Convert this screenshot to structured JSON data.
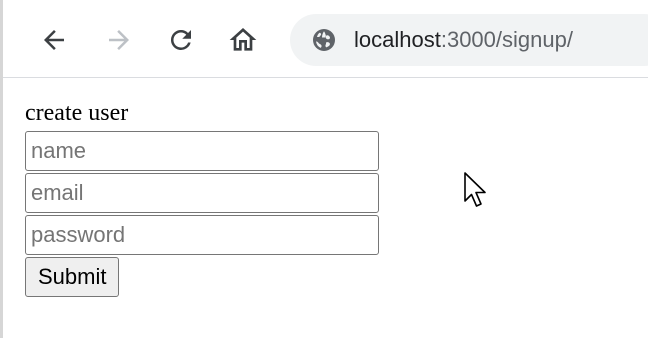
{
  "browser": {
    "back_icon": "arrow-left-icon",
    "forward_icon": "arrow-right-icon",
    "reload_icon": "reload-icon",
    "home_icon": "home-icon",
    "site_icon": "globe-icon",
    "url": {
      "host": "localhost",
      "rest": ":3000/signup/"
    }
  },
  "form": {
    "heading": "create user",
    "name_placeholder": "name",
    "email_placeholder": "email",
    "password_placeholder": "password",
    "name_value": "",
    "email_value": "",
    "password_value": "",
    "submit_label": "Submit"
  },
  "colors": {
    "icon_active": "#3c4043",
    "icon_disabled": "#bdc1c6",
    "omnibox_bg": "#f1f3f4",
    "button_bg": "#efefef"
  }
}
